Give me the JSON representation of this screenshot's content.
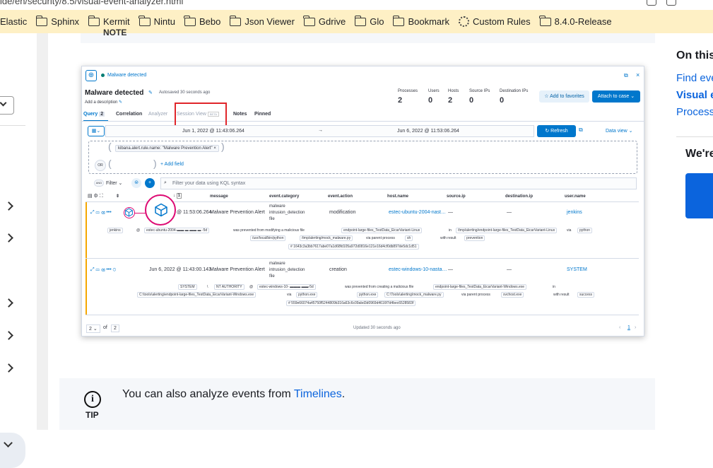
{
  "browser": {
    "url_fragment": "ide/en/security/8.5/visual-event-analyzer.html",
    "bookmarks": [
      {
        "label": "Elastic",
        "icon": "none"
      },
      {
        "label": "Sphinx",
        "icon": "folder-icon"
      },
      {
        "label": "Kermit",
        "icon": "folder-icon"
      },
      {
        "label": "Nintu",
        "icon": "folder-icon"
      },
      {
        "label": "Bebo",
        "icon": "folder-icon"
      },
      {
        "label": "Json Viewer",
        "icon": "folder-icon"
      },
      {
        "label": "Gdrive",
        "icon": "folder-icon"
      },
      {
        "label": "Glo",
        "icon": "folder-icon"
      },
      {
        "label": "Bookmark",
        "icon": "folder-icon"
      },
      {
        "label": "Custom Rules",
        "icon": "gear-icon"
      },
      {
        "label": "8.4.0-Release",
        "icon": "folder-icon"
      }
    ]
  },
  "doc": {
    "note_label": "NOTE",
    "tip": {
      "label": "TIP",
      "text_before": "You can also analyze events from ",
      "link": "Timelines",
      "text_after": "."
    }
  },
  "right_column": {
    "title": "On this",
    "links": [
      "Find eve",
      "Visual e",
      "Process"
    ],
    "were": "We're"
  },
  "screenshot": {
    "header_status": "Malware detected",
    "title": "Malware detected",
    "autosaved": "Autosaved 30 seconds ago",
    "description": "Add a description",
    "stats": [
      {
        "label": "Processes",
        "value": "2"
      },
      {
        "label": "Users",
        "value": "0"
      },
      {
        "label": "Hosts",
        "value": "2"
      },
      {
        "label": "Source IPs",
        "value": "0"
      },
      {
        "label": "Destination IPs",
        "value": "0"
      }
    ],
    "add_favorites": "Add to favorites",
    "attach_case": "Attach to case",
    "tabs": {
      "query": "Query",
      "query_count": "2",
      "correlation": "Correlation",
      "analyzer": "Analyzer",
      "session_view": "Session View",
      "beta": "BETA",
      "notes": "Notes",
      "pinned": "Pinned"
    },
    "date_start": "Jun 1, 2022 @ 11:43:06.264",
    "date_arrow": "→",
    "date_end": "Jun 6, 2022 @ 11:53:06.264",
    "refresh": "Refresh",
    "data_view": "Data view",
    "filter_pill": "kibana.alert.rule.name: \"Malware Prevention Alert\"",
    "or_label": "OR",
    "add_field": "+ Add field",
    "and_label": "AND",
    "filter_label": "Filter",
    "kql_placeholder": "Filter your data using KQL syntax",
    "sort_count": "1",
    "columns": [
      "message",
      "event.category",
      "event.action",
      "host.name",
      "source.ip",
      "destination.ip",
      "user.name"
    ],
    "rows": [
      {
        "time": "@ 11:53:06.264",
        "message": "Malware Prevention Alert",
        "category": [
          "malware",
          "intrusion_detection",
          "file"
        ],
        "action": "modification",
        "host": "estec-ubuntu-2004-nast…",
        "source": "—",
        "dest": "—",
        "user": "jenkins",
        "detail1_user": "jenkins",
        "detail1_at": "@",
        "detail1_host": "estec-ubuntu-2004-▬▬ ▬ ▬▬ ▬ -5d",
        "detail1_text": "was prevented from modifying a malicious file",
        "detail1_file": "endpoint-large-files_TestData_EicarVariant-Linux",
        "detail1_in": "in",
        "detail1_path": "/tmp/alerting/endpoint-large-files_TestData_EicarVariant-Linux",
        "detail1_via": "via",
        "detail1_proc": "python",
        "detail2_path": "/usr/local/bin/python",
        "detail2_script": "/tmp/alerting/mock_malware.py",
        "detail2_parent": "via parent process",
        "detail2_sh": "sh",
        "detail2_result": "with result",
        "detail2_prevent": "prevention",
        "hash": "1643c3a3bb7617abe07a1d68fd105a972d0816e121e16d4cf0db897de5dc1d51"
      },
      {
        "time": "Jun 6, 2022 @ 11:43:00.143",
        "message": "Malware Prevention Alert",
        "category": [
          "malware",
          "intrusion_detection",
          "file"
        ],
        "action": "creation",
        "host": "estec-windows-10-nasta…",
        "source": "—",
        "dest": "—",
        "user": "SYSTEM",
        "detail1_user": "SYSTEM",
        "detail1_sep": "\\",
        "detail1_auth": "NT AUTHORITY",
        "detail1_at": "@",
        "detail1_host": "estec-windows-10- ▬▬▬ ▬▬-5d",
        "detail1_text": "was prevented from creating a malicious file",
        "detail1_file": "endpoint-large-files_TestData_EicarVariant-Windows.exe",
        "detail1_in": "in",
        "detail2_path": "C:\\tools\\alerting\\endpoint-large-files_TestData_EicarVariant-Windows.exe",
        "detail2_via": "via",
        "detail2_proc": "python.exe",
        "detail2_proc2": "python.exe",
        "detail2_script": "C:\\Tools\\alerting\\mock_malware.py",
        "detail2_parent": "via parent process",
        "detail2_svc": "svchost.exe",
        "detail2_result": "with result",
        "detail2_success": "success",
        "hash": "559e66074a45750f5244809b316a63c6c09abd3d0969d4616f7d4bec6528583f"
      }
    ],
    "page_size": "2",
    "of_label": "of",
    "total": "2",
    "updated": "Updated 30 seconds ago",
    "page_num": "1"
  },
  "colors": {
    "bookmark_bar": "#fef0c5",
    "accent": "#0077cc",
    "highlight": "#e0252a",
    "magenta": "#dd0a73",
    "link": "#0b64dd"
  }
}
